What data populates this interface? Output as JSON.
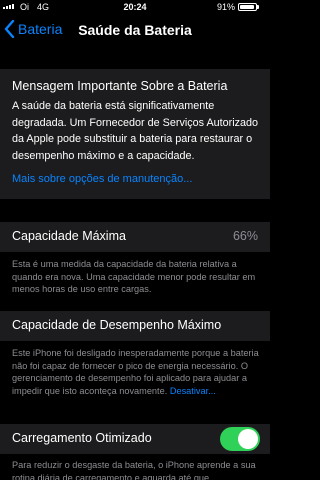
{
  "status_bar": {
    "carrier": "Oi",
    "network": "4G",
    "time": "20:24",
    "battery_percent": "91%",
    "battery_level": 0.91
  },
  "nav": {
    "back_label": "Bateria",
    "title": "Saúde da Bateria"
  },
  "message": {
    "title": "Mensagem Importante Sobre a Bateria",
    "body": "A saúde da bateria está significativamente degradada. Um Fornecedor de Serviços Autorizado da Apple pode substituir a bateria para restaurar o desempenho máximo e a capacidade.",
    "link": "Mais sobre opções de manutenção..."
  },
  "max_capacity": {
    "label": "Capacidade Máxima",
    "value": "66%",
    "footnote": "Esta é uma medida da capacidade da bateria relativa a quando era nova. Uma capacidade menor pode resultar em menos horas de uso entre cargas."
  },
  "peak_performance": {
    "label": "Capacidade de Desempenho Máximo",
    "footnote": "Este iPhone foi desligado inesperadamente porque a bateria não foi capaz de fornecer o pico de energia necessário. O gerenciamento de desempenho foi aplicado para ajudar a impedir que isto aconteça novamente.",
    "disable_link": "Desativar..."
  },
  "optimized_charging": {
    "label": "Carregamento Otimizado",
    "enabled": true,
    "footnote": "Para reduzir o desgaste da bateria, o iPhone aprende a sua rotina diária de carregamento e aguarda até que"
  },
  "colors": {
    "accent": "#0a84ff",
    "toggle_on": "#30d158",
    "background": "#000000",
    "cell": "#1c1c1e",
    "secondary_text": "#8e8e93"
  }
}
